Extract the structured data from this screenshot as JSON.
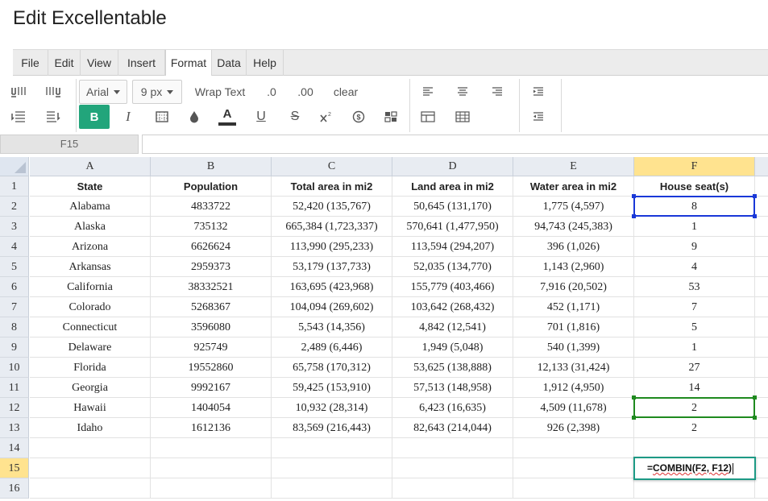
{
  "app": {
    "title": "Edit Excellentable"
  },
  "menu": [
    "File",
    "Edit",
    "View",
    "Insert",
    "Format",
    "Data",
    "Help"
  ],
  "menu_active": "Format",
  "toolbar": {
    "font_family": "Arial",
    "font_size": "9 px",
    "wrap_text": "Wrap Text",
    "decrease_decimal": ".0",
    "increase_decimal": ".00",
    "clear": "clear",
    "bold": "B",
    "italic": "I",
    "font_color": "A",
    "underline": "U",
    "strikethrough": "S",
    "accent_color": "#22a57b"
  },
  "formula_bar": {
    "cell_ref": "F15",
    "value": ""
  },
  "columns": [
    "A",
    "B",
    "C",
    "D",
    "E",
    "F"
  ],
  "rows": [
    [
      "State",
      "Population",
      "Total area in mi2",
      "Land area in mi2",
      "Water area in mi2",
      "House seat(s)"
    ],
    [
      "Alabama",
      "4833722",
      "52,420 (135,767)",
      "50,645 (131,170)",
      "1,775 (4,597)",
      "8"
    ],
    [
      "Alaska",
      "735132",
      "665,384 (1,723,337)",
      "570,641 (1,477,950)",
      "94,743 (245,383)",
      "1"
    ],
    [
      "Arizona",
      "6626624",
      "113,990 (295,233)",
      "113,594 (294,207)",
      "396 (1,026)",
      "9"
    ],
    [
      "Arkansas",
      "2959373",
      "53,179 (137,733)",
      "52,035 (134,770)",
      "1,143 (2,960)",
      "4"
    ],
    [
      "California",
      "38332521",
      "163,695 (423,968)",
      "155,779 (403,466)",
      "7,916 (20,502)",
      "53"
    ],
    [
      "Colorado",
      "5268367",
      "104,094 (269,602)",
      "103,642 (268,432)",
      "452 (1,171)",
      "7"
    ],
    [
      "Connecticut",
      "3596080",
      "5,543 (14,356)",
      "4,842 (12,541)",
      "701 (1,816)",
      "5"
    ],
    [
      "Delaware",
      "925749",
      "2,489 (6,446)",
      "1,949 (5,048)",
      "540 (1,399)",
      "1"
    ],
    [
      "Florida",
      "19552860",
      "65,758 (170,312)",
      "53,625 (138,888)",
      "12,133 (31,424)",
      "27"
    ],
    [
      "Georgia",
      "9992167",
      "59,425 (153,910)",
      "57,513 (148,958)",
      "1,912 (4,950)",
      "14"
    ],
    [
      "Hawaii",
      "1404054",
      "10,932 (28,314)",
      "6,423 (16,635)",
      "4,509 (11,678)",
      "2"
    ],
    [
      "Idaho",
      "1612136",
      "83,569 (216,443)",
      "82,643 (214,044)",
      "926 (2,398)",
      "2"
    ],
    [
      "",
      "",
      "",
      "",
      "",
      ""
    ],
    [
      "",
      "",
      "",
      "",
      "",
      ""
    ],
    [
      "",
      "",
      "",
      "",
      "",
      ""
    ]
  ],
  "row_numbers": [
    "1",
    "2",
    "3",
    "4",
    "5",
    "6",
    "7",
    "8",
    "9",
    "10",
    "11",
    "12",
    "13",
    "14",
    "15",
    "16"
  ],
  "editor": {
    "cell": "F15",
    "text": "=COMBIN(F2, F12)",
    "func": "COMBIN",
    "args": "F2, F12"
  },
  "colors": {
    "selected_header": "#ffe38f",
    "range_blue": "#1a38d8",
    "range_green": "#1f8a1f",
    "editor_border": "#1d9a85"
  }
}
